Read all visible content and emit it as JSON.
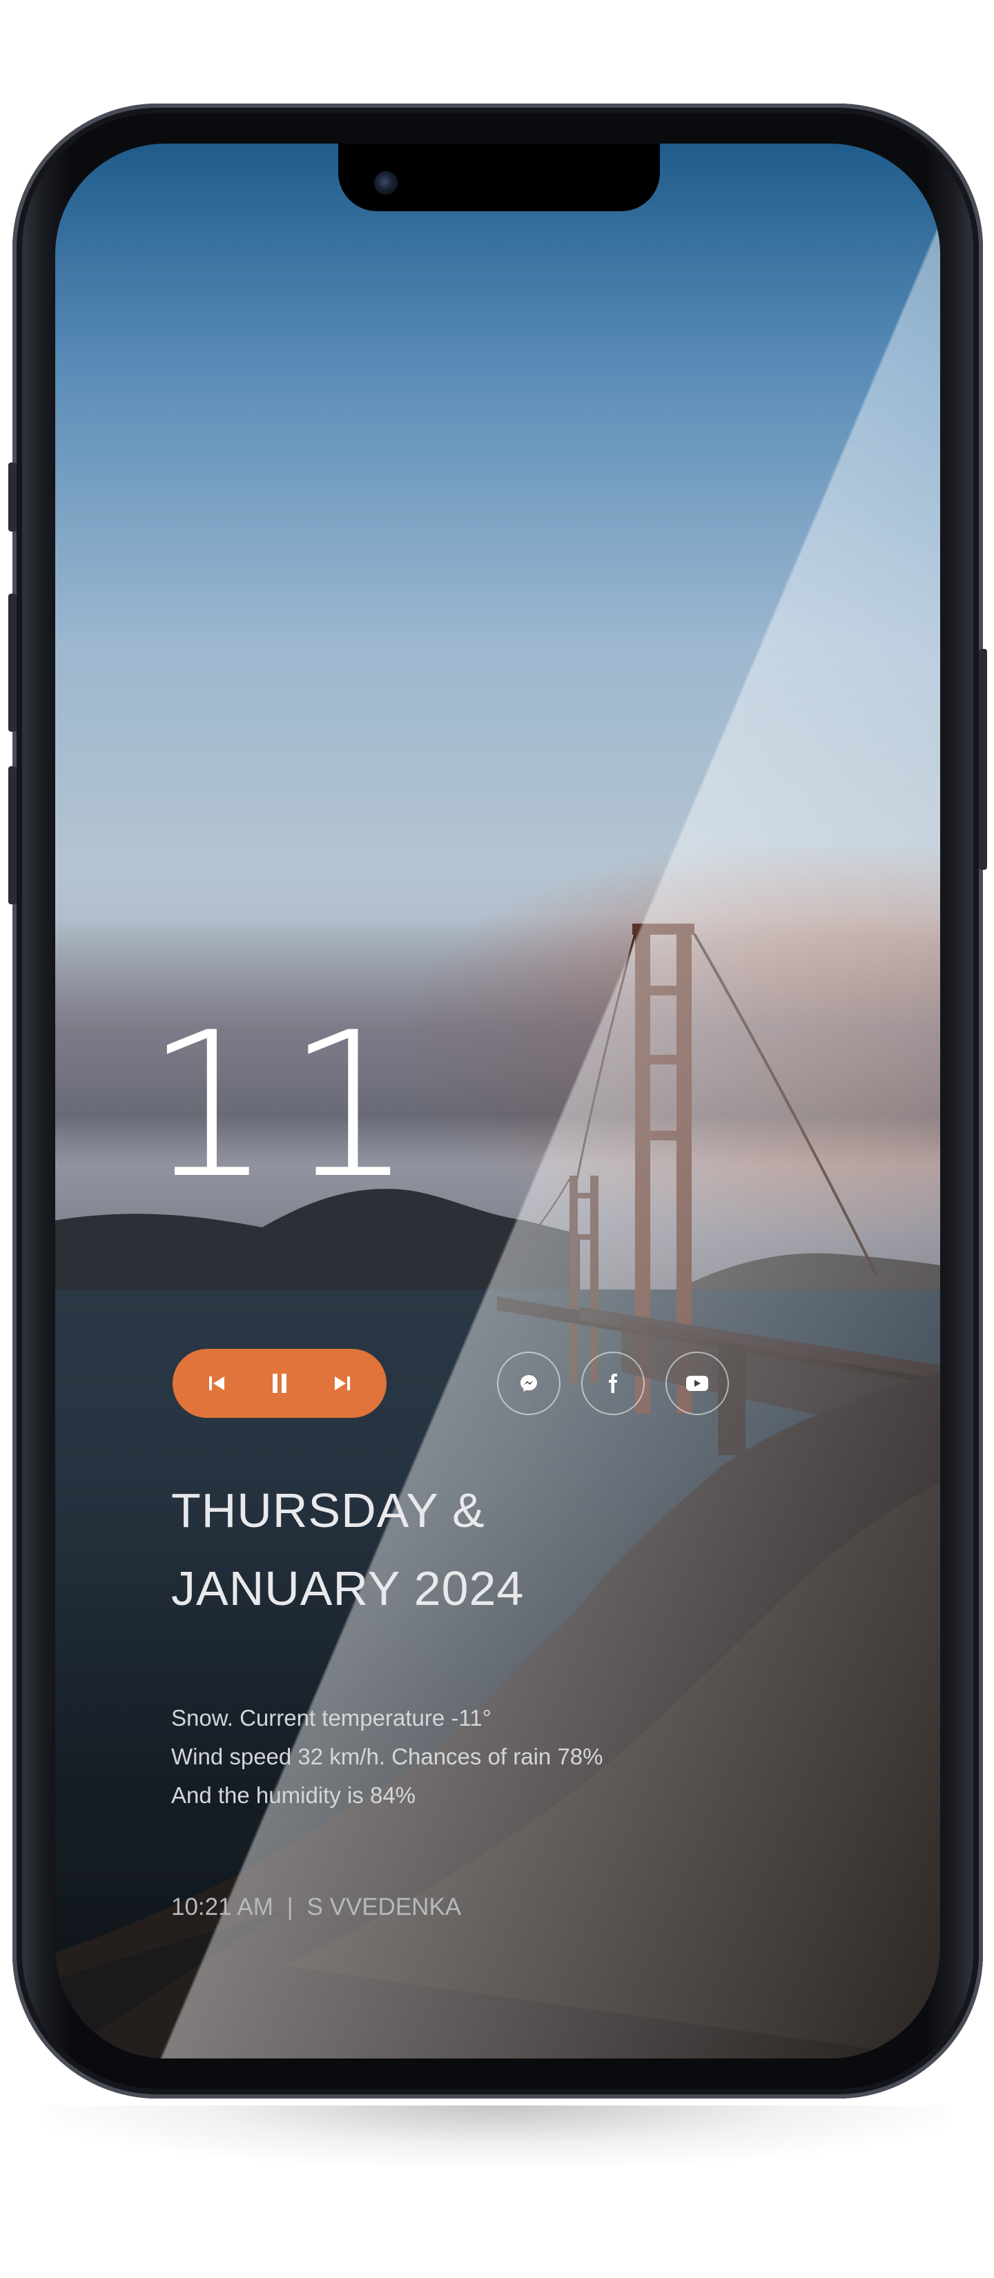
{
  "lockscreen": {
    "day_number": "11",
    "date_line1": "THURSDAY &",
    "date_line2": "JANUARY 2024",
    "weather": {
      "line1": "Snow. Current temperature -11°",
      "line2": "Wind speed 32 km/h. Chances of rain 78%",
      "line3": "And the humidity is 84%"
    },
    "footer": {
      "time": "10:21 AM",
      "separator": "|",
      "author": "S VVEDENKA"
    }
  },
  "media_player": {
    "accent_color": "#e0743b",
    "controls": [
      {
        "name": "previous",
        "icon": "skip-previous-icon"
      },
      {
        "name": "pause",
        "icon": "pause-icon"
      },
      {
        "name": "next",
        "icon": "skip-next-icon"
      }
    ]
  },
  "social_links": [
    {
      "name": "messenger",
      "icon": "messenger-icon"
    },
    {
      "name": "facebook",
      "icon": "facebook-icon"
    },
    {
      "name": "youtube",
      "icon": "youtube-icon"
    }
  ]
}
